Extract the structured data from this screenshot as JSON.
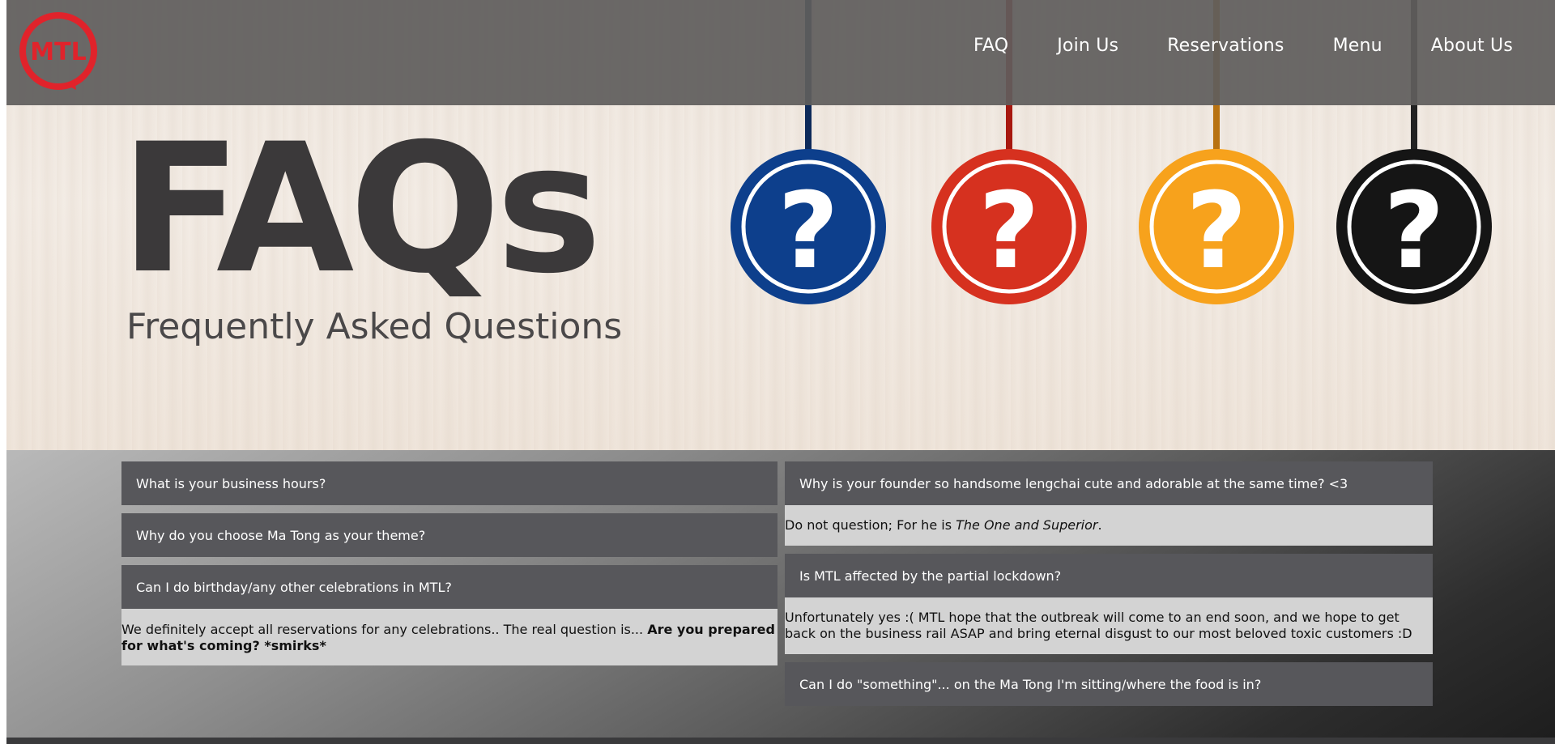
{
  "brand": {
    "logo_text": "MTL",
    "accent": "#e0232b"
  },
  "nav": {
    "items": [
      {
        "label": "FAQ"
      },
      {
        "label": "Join Us"
      },
      {
        "label": "Reservations"
      },
      {
        "label": "Menu"
      },
      {
        "label": "About Us"
      }
    ]
  },
  "hero": {
    "title": "FAQs",
    "subtitle": "Frequently Asked Questions",
    "pendants": [
      {
        "color": "#0d3f8c",
        "glyph": "?"
      },
      {
        "color": "#d6311f",
        "glyph": "?"
      },
      {
        "color": "#f7a21c",
        "glyph": "?"
      },
      {
        "color": "#151515",
        "glyph": "?"
      }
    ]
  },
  "faq": {
    "left": [
      {
        "question": "What is your business hours?"
      },
      {
        "question": "Why do you choose Ma Tong as your theme?"
      },
      {
        "question": "Can I do birthday/any other celebrations in MTL?",
        "answer_text": "We definitely accept all reservations for any celebrations.. The real question is... ",
        "answer_bold": "Are you prepared for what's coming? *smirks*"
      }
    ],
    "right": [
      {
        "question": "Why is your founder so handsome lengchai cute and adorable at the same time? <3",
        "answer_text": "Do not question; For he is ",
        "answer_italic": "The One and Superior",
        "answer_end": "."
      },
      {
        "question": "Is MTL affected by the partial lockdown?",
        "answer_text": "Unfortunately yes :( MTL hope that the outbreak will come to an end soon, and we hope to get back on the business rail ASAP and bring eternal disgust to our most beloved toxic customers :D"
      },
      {
        "question": "Can I do \"something\"... on the Ma Tong I'm sitting/where the food is in?"
      }
    ]
  }
}
